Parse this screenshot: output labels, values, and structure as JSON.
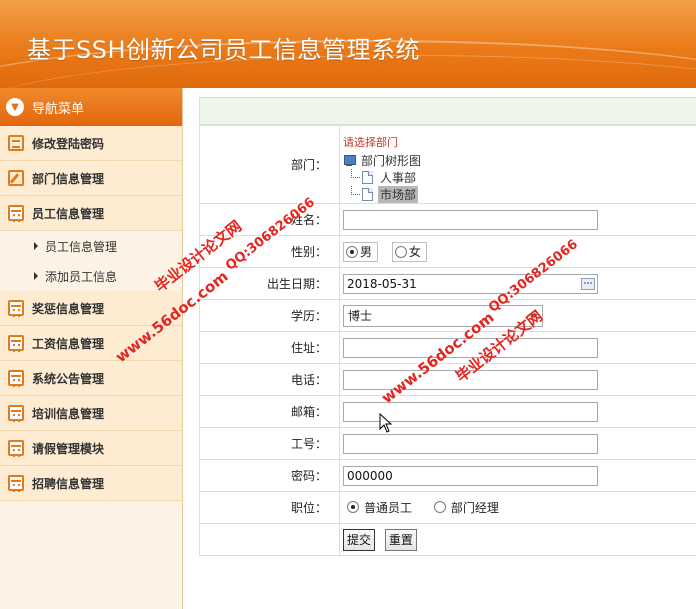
{
  "header": {
    "title": "基于SSH创新公司员工信息管理系统"
  },
  "sidebar": {
    "nav_title": "导航菜单",
    "items": [
      {
        "label": "修改登陆密码",
        "icon": "chat-icon"
      },
      {
        "label": "部门信息管理",
        "icon": "edit-icon"
      },
      {
        "label": "员工信息管理",
        "icon": "calendar-icon",
        "children": [
          {
            "label": "员工信息管理"
          },
          {
            "label": "添加员工信息"
          }
        ]
      },
      {
        "label": "奖惩信息管理",
        "icon": "calendar-icon"
      },
      {
        "label": "工资信息管理",
        "icon": "calendar-icon"
      },
      {
        "label": "系统公告管理",
        "icon": "calendar-icon"
      },
      {
        "label": "培训信息管理",
        "icon": "calendar-icon"
      },
      {
        "label": "请假管理模块",
        "icon": "calendar-icon"
      },
      {
        "label": "招聘信息管理",
        "icon": "calendar-icon"
      }
    ]
  },
  "form": {
    "dept": {
      "label": "部门：",
      "hint": "请选择部门",
      "root": "部门树形图",
      "nodes": [
        "人事部",
        "市场部"
      ],
      "selected": "市场部"
    },
    "name": {
      "label": "姓名：",
      "value": ""
    },
    "gender": {
      "label": "性别：",
      "options": [
        "男",
        "女"
      ],
      "selected": "男"
    },
    "birth": {
      "label": "出生日期：",
      "value": "2018-05-31"
    },
    "edu": {
      "label": "学历：",
      "value": "博士"
    },
    "address": {
      "label": "住址：",
      "value": ""
    },
    "phone": {
      "label": "电话：",
      "value": ""
    },
    "email": {
      "label": "邮箱：",
      "value": ""
    },
    "empno": {
      "label": "工号：",
      "value": ""
    },
    "password": {
      "label": "密码：",
      "value": "000000"
    },
    "position": {
      "label": "职位：",
      "options": [
        "普通员工",
        "部门经理"
      ],
      "selected": "普通员工"
    },
    "submit_label": "提交",
    "reset_label": "重置"
  },
  "watermarks": {
    "brand": "毕业设计论文网",
    "site": "www.56doc.com",
    "qq": "QQ:306826066"
  },
  "colors": {
    "header": "#ea7a18",
    "watermark": "#e3261f",
    "hint": "#c23a2a"
  }
}
